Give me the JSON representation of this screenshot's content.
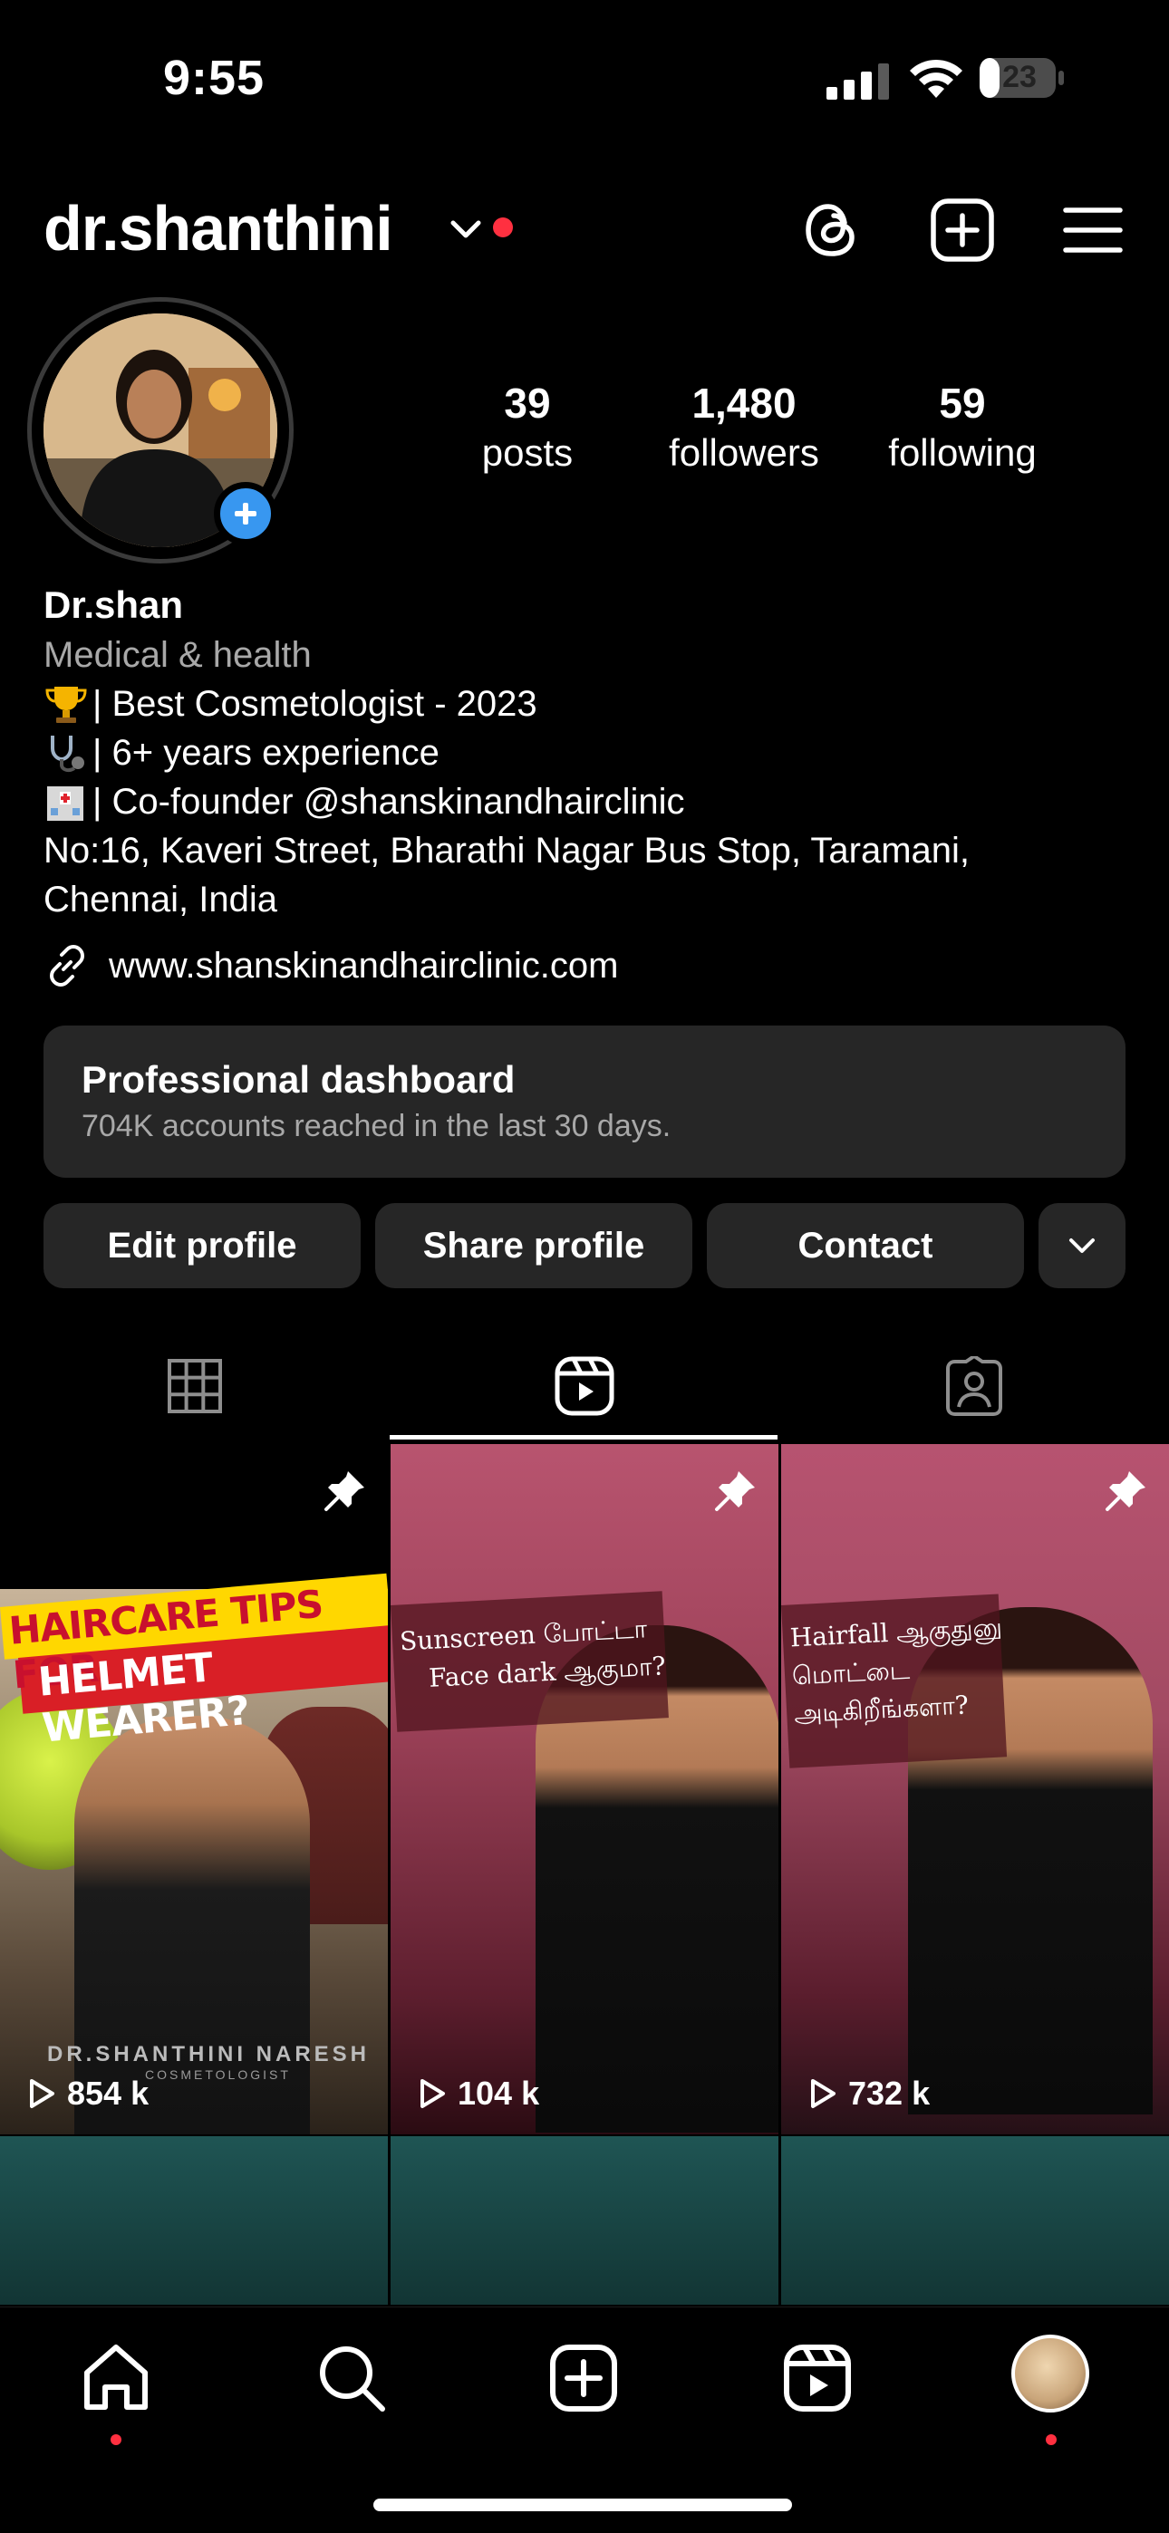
{
  "status_bar": {
    "time": "9:55",
    "battery": "23"
  },
  "header": {
    "username": "dr.shanthini"
  },
  "stats": [
    {
      "value": "39",
      "label": "posts"
    },
    {
      "value": "1,480",
      "label": "followers"
    },
    {
      "value": "59",
      "label": "following"
    }
  ],
  "bio": {
    "name": "Dr.shan",
    "category": "Medical & health",
    "lines": [
      "| Best Cosmetologist - 2023",
      "| 6+ years experience",
      "| Co-founder @shanskinandhairclinic"
    ],
    "address_line1": "No:16, Kaveri Street, Bharathi Nagar Bus Stop, Taramani,",
    "address_line2": "Chennai, India",
    "link": "www.shanskinandhairclinic.com"
  },
  "dashboard": {
    "title": "Professional dashboard",
    "subtitle": "704K accounts reached in the last 30 days."
  },
  "buttons": {
    "edit": "Edit profile",
    "share": "Share profile",
    "contact": "Contact"
  },
  "reels": [
    {
      "banner_line1": "HAIRCARE TIPS FOR",
      "banner_line2": "HELMET WEARER?",
      "watermark": "DR.SHANTHINI NARESH",
      "watermark_sub": "COSMETOLOGIST",
      "views": "854 k"
    },
    {
      "caption_line1": "Sunscreen போட்டா",
      "caption_line2": "Face dark ஆகுமா?",
      "views": "104 k"
    },
    {
      "caption_line1": "Hairfall ஆகுதுனு",
      "caption_line2": "மொட்டை",
      "caption_line3": "அடிகிறீங்களா?",
      "views": "732 k"
    }
  ],
  "colors": {
    "accent_blue": "#3897f0",
    "notification_red": "#ff3040",
    "surface": "#262626",
    "muted_text": "#a8a8a8"
  }
}
